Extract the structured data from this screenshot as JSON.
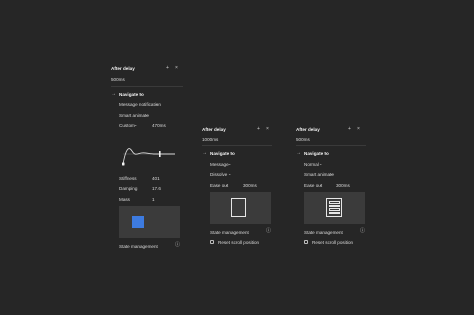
{
  "panels": [
    {
      "trigger": "After delay",
      "delay": "500ms",
      "action": "Navigate to",
      "destination": "Message notification",
      "animation": "Smart animate",
      "easing": "Custom",
      "duration": "470ms",
      "spring": {
        "stiffness_label": "Stiffness",
        "stiffness": "401",
        "damping_label": "Damping",
        "damping": "17.6",
        "mass_label": "Mass",
        "mass": "1"
      },
      "footer": "State management"
    },
    {
      "trigger": "After delay",
      "delay": "1000ms",
      "action": "Navigate to",
      "destination": "Message",
      "animation": "Dissolve",
      "easing": "Ease out",
      "duration": "300ms",
      "footer": "State management",
      "checkbox_label": "Reset scroll position"
    },
    {
      "trigger": "After delay",
      "delay": "500ms",
      "action": "Navigate to",
      "destination": "Normal",
      "animation": "Smart animate",
      "easing": "Ease out",
      "duration": "300ms",
      "footer": "State management",
      "checkbox_label": "Reset scroll position"
    }
  ],
  "icons": {
    "plus": "+",
    "close": "×",
    "arrow": "→",
    "chevron": "⌄",
    "info": "ⓘ"
  },
  "colors": {
    "background": "#262626",
    "preview_bg": "#3b3b3b",
    "accent_square": "#3d7be0"
  }
}
